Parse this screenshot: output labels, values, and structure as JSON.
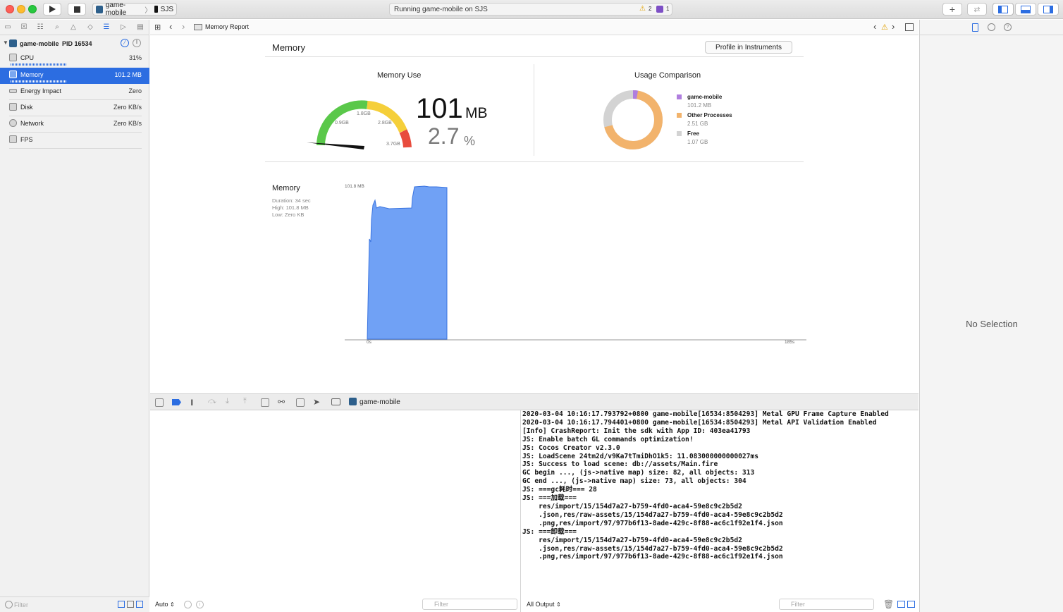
{
  "toolbar": {
    "scheme_name": "game-mobile",
    "device_name": "SJS",
    "activity_text": "Running game-mobile on SJS",
    "warning_count": "2",
    "issue_count": "1"
  },
  "navigator": {
    "process_name": "game-mobile",
    "pid_label": "PID 16534",
    "gauges": [
      {
        "label": "CPU",
        "value": "31%"
      },
      {
        "label": "Memory",
        "value": "101.2 MB"
      },
      {
        "label": "Energy Impact",
        "value": "Zero"
      },
      {
        "label": "Disk",
        "value": "Zero KB/s"
      },
      {
        "label": "Network",
        "value": "Zero KB/s"
      },
      {
        "label": "FPS",
        "value": ""
      }
    ],
    "filter_placeholder": "Filter"
  },
  "jumpbar": {
    "title": "Memory Report"
  },
  "report": {
    "title": "Memory",
    "profile_button": "Profile in Instruments",
    "memory_use": {
      "title": "Memory Use",
      "value": "101",
      "unit": "MB",
      "percent": "2.7",
      "percent_unit": "%",
      "ticks": [
        "0.9GB",
        "1.8GB",
        "2.8GB",
        "3.7GB"
      ]
    },
    "usage_comparison": {
      "title": "Usage Comparison",
      "legend": [
        {
          "name": "game-mobile",
          "value": "101.2 MB",
          "color": "#b07ede"
        },
        {
          "name": "Other Processes",
          "value": "2.51 GB",
          "color": "#f2b36c"
        },
        {
          "name": "Free",
          "value": "1.07 GB",
          "color": "#d3d3d3"
        }
      ]
    },
    "graph": {
      "title": "Memory",
      "duration": "Duration: 34 sec",
      "high": "High: 101.8 MB",
      "low": "Low: Zero KB",
      "y_max_label": "101.8 MB",
      "x_start_label": "0s",
      "x_end_label": "185s"
    }
  },
  "debug": {
    "process_label": "game-mobile",
    "auto_label": "Auto",
    "output_label": "All Output",
    "filter_placeholder": "Filter"
  },
  "inspector": {
    "empty_text": "No Selection"
  },
  "console_lines": [
    "2020-03-04 10:16:17.793792+0800 game-mobile[16534:8504293] Metal GPU Frame Capture Enabled",
    "2020-03-04 10:16:17.794401+0800 game-mobile[16534:8504293] Metal API Validation Enabled",
    "[Info] CrashReport: Init the sdk with App ID: 403ea41793",
    "JS: Enable batch GL commands optimization!",
    "JS: Cocos Creator v2.3.0",
    "JS: LoadScene 24tm2d/v9Ka7tTmiDhO1k5: 11.083000000000027ms",
    "JS: Success to load scene: db://assets/Main.fire",
    "GC begin ..., (js->native map) size: 82, all objects: 313",
    "GC end ..., (js->native map) size: 73, all objects: 304",
    "JS: ===gc耗时=== 28",
    "JS: ===加载===",
    "    res/import/15/154d7a27-b759-4fd0-aca4-59e8c9c2b5d2",
    "    .json,res/raw-assets/15/154d7a27-b759-4fd0-aca4-59e8c9c2b5d2",
    "    .png,res/import/97/977b6f13-8ade-429c-8f88-ac6c1f92e1f4.json",
    "JS: ===卸载===",
    "    res/import/15/154d7a27-b759-4fd0-aca4-59e8c9c2b5d2",
    "    .json,res/raw-assets/15/154d7a27-b759-4fd0-aca4-59e8c9c2b5d2",
    "    .png,res/import/97/977b6f13-8ade-429c-8f88-ac6c1f92e1f4.json"
  ]
}
